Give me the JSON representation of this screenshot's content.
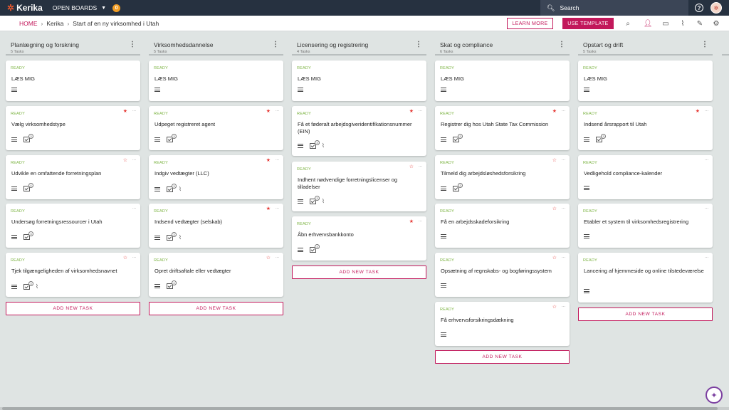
{
  "topbar": {
    "logo": "Kerika",
    "open_boards": "OPEN BOARDS",
    "notification_count": "0",
    "search_placeholder": "Search",
    "help": "?"
  },
  "subbar": {
    "breadcrumbs": [
      "HOME",
      "Kerika",
      "Start af en ny virksomhed i Utah"
    ],
    "learn_more": "LEARN MORE",
    "use_template": "USE TEMPLATE"
  },
  "toolbar_icons": [
    "search-icon",
    "add-person-icon",
    "chat-icon",
    "attachment-icon",
    "tools-icon",
    "settings-icon"
  ],
  "status_color": "#7cb342",
  "accent_color": "#c2185b",
  "columns": [
    {
      "title": "Planlægning og forskning",
      "count": "5 Tasks",
      "add_label": "ADD NEW TASK",
      "cards": [
        {
          "status": "READY",
          "title": "LÆS MIG",
          "star": "",
          "dots": "",
          "checklist": "",
          "clip": false
        },
        {
          "status": "READY",
          "title": "Vælg virksomhedstype",
          "star": "★",
          "dots": "...",
          "checklist": "3",
          "clip": false
        },
        {
          "status": "READY",
          "title": "Udvikle en omfattende forretningsplan",
          "star": "☆",
          "dots": "...",
          "checklist": "4",
          "clip": false
        },
        {
          "status": "READY",
          "title": "Undersøg forretningsressourcer i Utah",
          "star": "",
          "dots": "...",
          "checklist": "3",
          "clip": false
        },
        {
          "status": "READY",
          "title": "Tjek tilgængeligheden af virksomhedsnavnet",
          "star": "☆",
          "dots": "...",
          "checklist": "3",
          "clip": true
        }
      ]
    },
    {
      "title": "Virksomhedsdannelse",
      "count": "5 Tasks",
      "add_label": "ADD NEW TASK",
      "cards": [
        {
          "status": "READY",
          "title": "LÆS MIG",
          "star": "",
          "dots": "",
          "checklist": "",
          "clip": false
        },
        {
          "status": "READY",
          "title": "Udpeget registreret agent",
          "star": "★",
          "dots": "...",
          "checklist": "3",
          "clip": false
        },
        {
          "status": "READY",
          "title": "Indgiv vedtægter (LLC)",
          "star": "★",
          "dots": "...",
          "checklist": "3",
          "clip": true
        },
        {
          "status": "READY",
          "title": "Indsend vedtægter (selskab)",
          "star": "★",
          "dots": "...",
          "checklist": "3",
          "clip": true
        },
        {
          "status": "READY",
          "title": "Opret driftsaftale eller vedtægter",
          "star": "☆",
          "dots": "...",
          "checklist": "4",
          "clip": false
        }
      ]
    },
    {
      "title": "Licensering og registrering",
      "count": "4 Tasks",
      "add_label": "ADD NEW TASK",
      "cards": [
        {
          "status": "READY",
          "title": "LÆS MIG",
          "star": "",
          "dots": "",
          "checklist": "",
          "clip": false
        },
        {
          "status": "READY",
          "title": "Få et føderalt arbejdsgiveridentifikationsnummer (EIN)",
          "star": "★",
          "dots": "...",
          "checklist": "3",
          "clip": true
        },
        {
          "status": "READY",
          "title": "Indhent nødvendige forretningslicenser og tilladelser",
          "star": "☆",
          "dots": "...",
          "checklist": "3",
          "clip": true
        },
        {
          "status": "READY",
          "title": "Åbn erhvervsbankkonto",
          "star": "★",
          "dots": "...",
          "checklist": "4",
          "clip": false
        }
      ]
    },
    {
      "title": "Skat og compliance",
      "count": "6 Tasks",
      "add_label": "ADD NEW TASK",
      "cards": [
        {
          "status": "READY",
          "title": "LÆS MIG",
          "star": "",
          "dots": "",
          "checklist": "",
          "clip": false
        },
        {
          "status": "READY",
          "title": "Registrer dig hos Utah State Tax Commission",
          "star": "★",
          "dots": "...",
          "checklist": "3",
          "clip": false
        },
        {
          "status": "READY",
          "title": "Tilmeld dig arbejdsløshedsforsikring",
          "star": "☆",
          "dots": "...",
          "checklist": "3",
          "clip": false
        },
        {
          "status": "READY",
          "title": "Få en arbejdsskadeforsikring",
          "star": "☆",
          "dots": "...",
          "checklist": "",
          "clip": false
        },
        {
          "status": "READY",
          "title": "Opsætning af regnskabs- og bogføringssystem",
          "star": "☆",
          "dots": "...",
          "checklist": "",
          "clip": false
        },
        {
          "status": "READY",
          "title": "Få erhvervsforsikringsdækning",
          "star": "☆",
          "dots": "...",
          "checklist": "",
          "clip": false
        }
      ]
    },
    {
      "title": "Opstart og drift",
      "count": "5 Tasks",
      "add_label": "ADD NEW TASK",
      "cards": [
        {
          "status": "READY",
          "title": "LÆS MIG",
          "star": "",
          "dots": "",
          "checklist": "",
          "clip": false
        },
        {
          "status": "READY",
          "title": "Indsend årsrapport til Utah",
          "star": "★",
          "dots": "...",
          "checklist": "3",
          "clip": false
        },
        {
          "status": "READY",
          "title": "Vedligehold compliance-kalender",
          "star": "",
          "dots": "...",
          "checklist": "",
          "clip": false
        },
        {
          "status": "READY",
          "title": "Etabler et system til virksomhedsregistrering",
          "star": "",
          "dots": "...",
          "checklist": "",
          "clip": false
        },
        {
          "status": "READY",
          "title": "Lancering af hjemmeside og online tilstedeværelse",
          "star": "",
          "dots": "...",
          "checklist": "",
          "clip": false
        }
      ]
    }
  ]
}
